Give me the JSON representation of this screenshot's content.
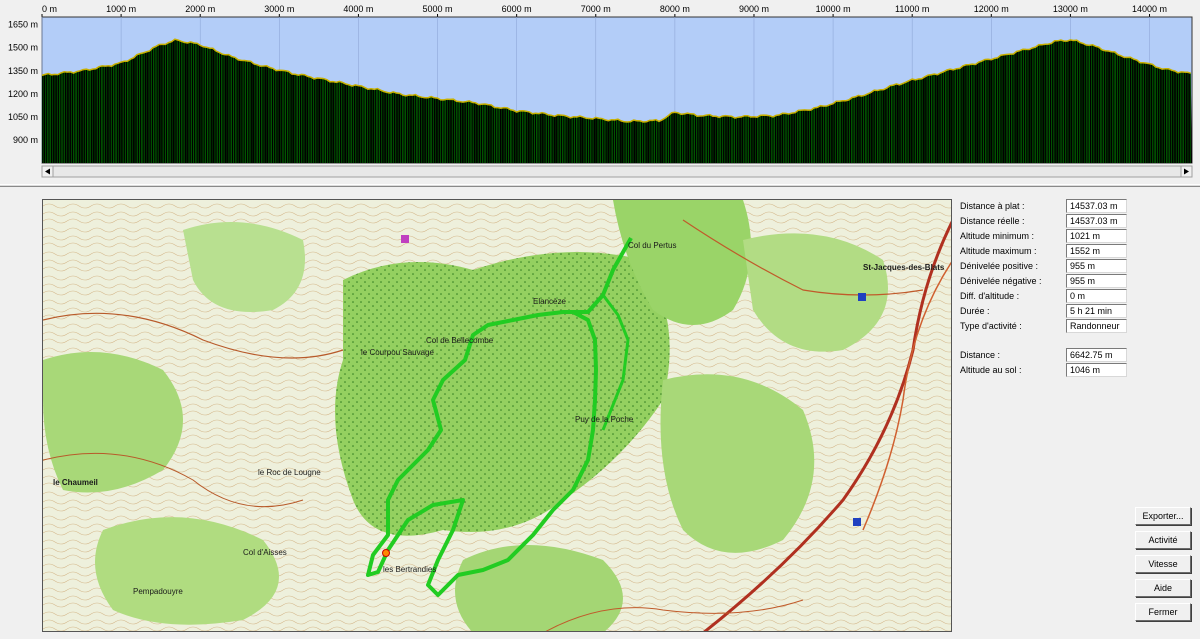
{
  "profile": {
    "x_ticks": [
      "0 m",
      "1000 m",
      "2000 m",
      "3000 m",
      "4000 m",
      "5000 m",
      "6000 m",
      "7000 m",
      "8000 m",
      "9000 m",
      "10000 m",
      "11000 m",
      "12000 m",
      "13000 m",
      "14000 m"
    ],
    "y_ticks": [
      "1650 m",
      "1500 m",
      "1350 m",
      "1200 m",
      "1050 m",
      "900 m"
    ],
    "elevation": [
      [
        0,
        1320
      ],
      [
        500,
        1350
      ],
      [
        1000,
        1400
      ],
      [
        1500,
        1520
      ],
      [
        1700,
        1550
      ],
      [
        2000,
        1520
      ],
      [
        2400,
        1440
      ],
      [
        2800,
        1380
      ],
      [
        3200,
        1330
      ],
      [
        3600,
        1290
      ],
      [
        4000,
        1250
      ],
      [
        4500,
        1200
      ],
      [
        5000,
        1170
      ],
      [
        5500,
        1140
      ],
      [
        6000,
        1090
      ],
      [
        6500,
        1060
      ],
      [
        7000,
        1040
      ],
      [
        7400,
        1021
      ],
      [
        7800,
        1025
      ],
      [
        8000,
        1080
      ],
      [
        8300,
        1060
      ],
      [
        8800,
        1050
      ],
      [
        9300,
        1060
      ],
      [
        9800,
        1110
      ],
      [
        10300,
        1180
      ],
      [
        10800,
        1260
      ],
      [
        11300,
        1330
      ],
      [
        11800,
        1400
      ],
      [
        12300,
        1470
      ],
      [
        12800,
        1540
      ],
      [
        13000,
        1552
      ],
      [
        13300,
        1510
      ],
      [
        13700,
        1440
      ],
      [
        14200,
        1360
      ],
      [
        14537,
        1330
      ]
    ],
    "colors": {
      "sky": "#b3cdf8",
      "ground": "#000000",
      "trace": "#00c000",
      "edge": "#c8b000"
    }
  },
  "map": {
    "labels": [
      {
        "text": "Col de Bellecombe",
        "kind": "place"
      },
      {
        "text": "le Courpou Sauvage",
        "kind": "place"
      },
      {
        "text": "Puy de la Poche",
        "kind": "place"
      },
      {
        "text": "Col du Pertus",
        "kind": "place"
      },
      {
        "text": "St-Jacques-des-Blats",
        "kind": "place"
      },
      {
        "text": "Col d'Aisses",
        "kind": "place"
      },
      {
        "text": "Pempadouyre",
        "kind": "place"
      },
      {
        "text": "le Chaumeil",
        "kind": "place"
      },
      {
        "text": "Elancèze",
        "kind": "place"
      },
      {
        "text": "le Roc de Lougne",
        "kind": "place"
      },
      {
        "text": "les Bertrandies",
        "kind": "place"
      }
    ],
    "colors": {
      "forest": "#8fcf5a",
      "meadow": "#e8f0d8",
      "route": "#22cc22",
      "road": "#b03020"
    }
  },
  "stats": [
    {
      "label": "Distance à plat :",
      "value": "14537.03 m"
    },
    {
      "label": "Distance réelle :",
      "value": "14537.03 m"
    },
    {
      "label": "Altitude minimum :",
      "value": "1021 m"
    },
    {
      "label": "Altitude maximum :",
      "value": "1552 m"
    },
    {
      "label": "Dénivelée positive :",
      "value": "955 m"
    },
    {
      "label": "Dénivelée négative :",
      "value": "955 m"
    },
    {
      "label": "Diff. d'altitude :",
      "value": "0 m"
    },
    {
      "label": "Durée :",
      "value": "5 h 21 min"
    },
    {
      "label": "Type d'activité :",
      "value": "Randonneur"
    },
    {
      "label": "Distance :",
      "value": "6642.75 m"
    },
    {
      "label": "Altitude au sol :",
      "value": "1046 m"
    }
  ],
  "buttons": {
    "export": "Exporter...",
    "activity": "Activité",
    "speed": "Vitesse",
    "help": "Aide",
    "close": "Fermer"
  }
}
